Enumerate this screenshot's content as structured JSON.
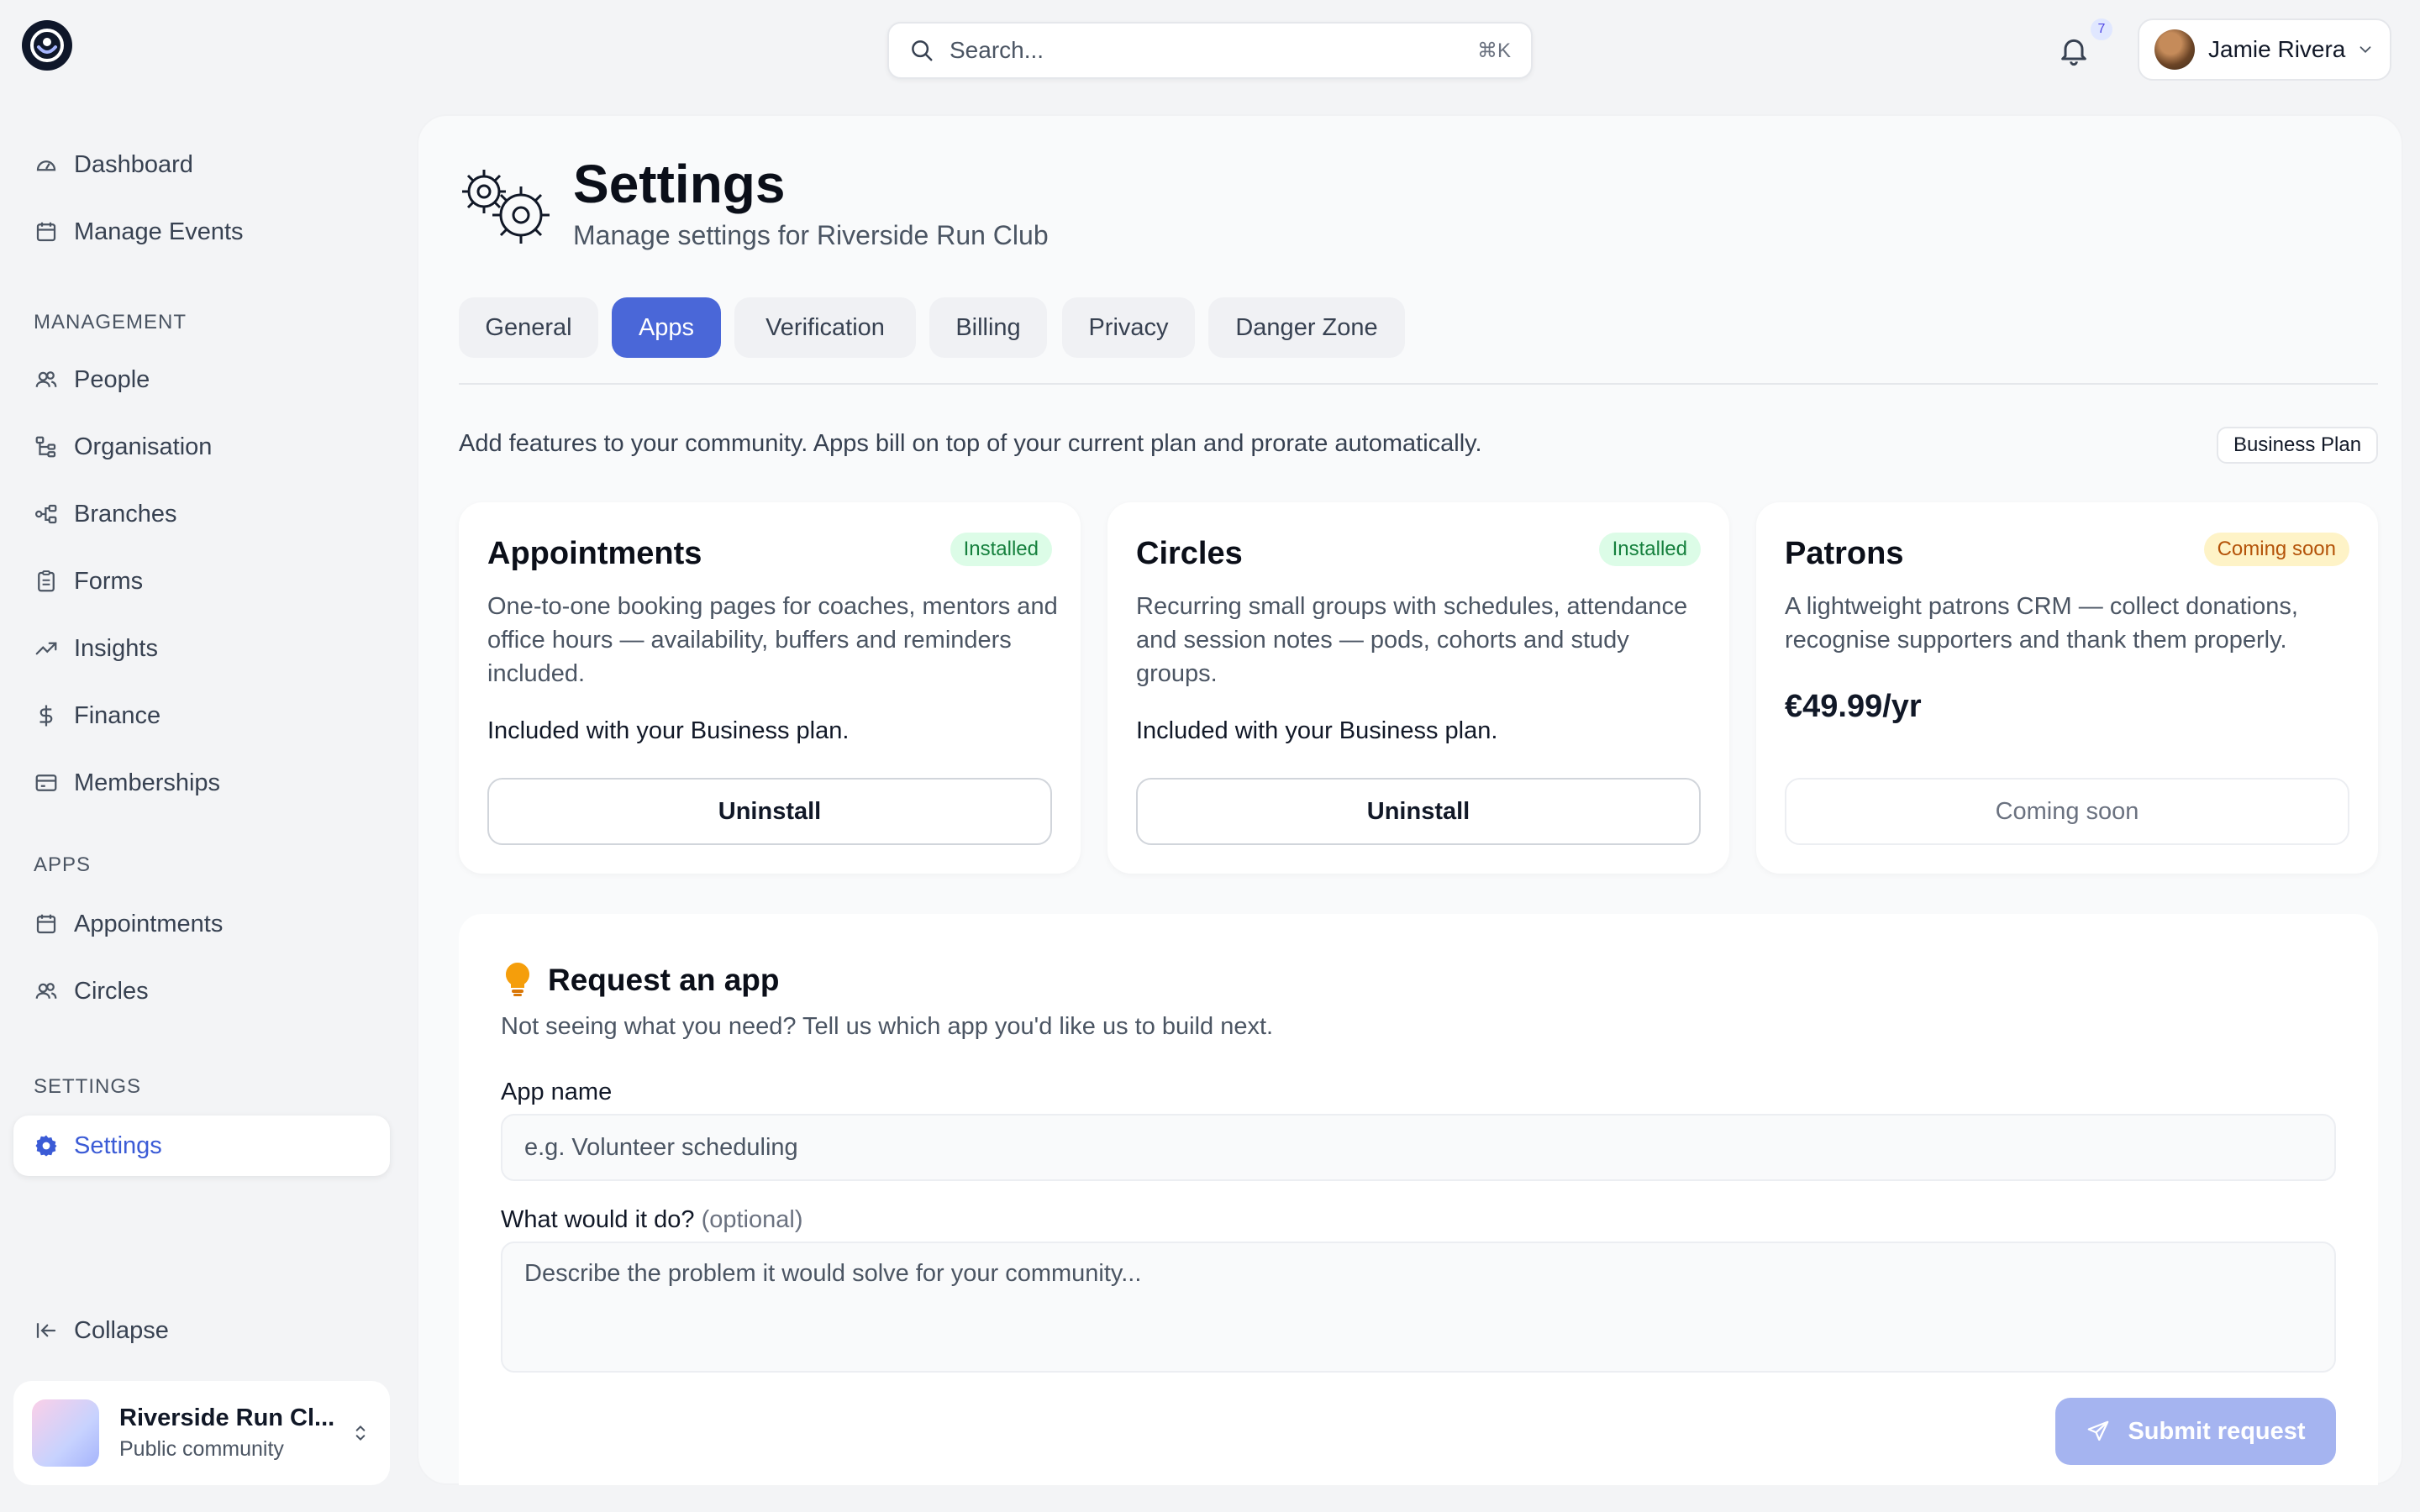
{
  "topbar": {
    "search_placeholder": "Search...",
    "search_shortcut": "⌘K",
    "notification_count": "7",
    "user_name": "Jamie Rivera"
  },
  "sidebar": {
    "top_items": [
      {
        "label": "Dashboard",
        "icon": "gauge-icon"
      },
      {
        "label": "Manage Events",
        "icon": "calendar-icon"
      }
    ],
    "management_label": "MANAGEMENT",
    "management_items": [
      {
        "label": "People",
        "icon": "users-icon"
      },
      {
        "label": "Organisation",
        "icon": "org-tree-icon"
      },
      {
        "label": "Branches",
        "icon": "branches-icon"
      },
      {
        "label": "Forms",
        "icon": "clipboard-icon"
      },
      {
        "label": "Insights",
        "icon": "trend-icon"
      },
      {
        "label": "Finance",
        "icon": "dollar-icon"
      },
      {
        "label": "Memberships",
        "icon": "card-icon"
      }
    ],
    "apps_label": "APPS",
    "apps_items": [
      {
        "label": "Appointments",
        "icon": "calendar-icon"
      },
      {
        "label": "Circles",
        "icon": "users-icon"
      }
    ],
    "settings_label": "SETTINGS",
    "settings_item": {
      "label": "Settings",
      "icon": "gear-icon"
    },
    "collapse_label": "Collapse",
    "community": {
      "name": "Riverside Run Cl...",
      "type": "Public community"
    }
  },
  "page": {
    "title": "Settings",
    "subtitle": "Manage settings for Riverside Run Club"
  },
  "tabs": [
    "General",
    "Apps",
    "Verification",
    "Billing",
    "Privacy",
    "Danger Zone"
  ],
  "active_tab": "Apps",
  "apps_intro": "Add features to your community. Apps bill on top of your current plan and prorate automatically.",
  "plan_badge": "Business Plan",
  "cards": [
    {
      "name": "Appointments",
      "badge": "Installed",
      "description": "One-to-one booking pages for coaches, mentors and office hours — availability, buffers and reminders included.",
      "included": "Included with your Business plan.",
      "button": "Uninstall"
    },
    {
      "name": "Circles",
      "badge": "Installed",
      "description": "Recurring small groups with schedules, attendance and session notes — pods, cohorts and study groups.",
      "included": "Included with your Business plan.",
      "button": "Uninstall"
    },
    {
      "name": "Patrons",
      "badge": "Coming soon",
      "description": "A lightweight patrons CRM — collect donations, recognise supporters and thank them properly.",
      "price": "€49.99/yr",
      "button": "Coming soon"
    }
  ],
  "request": {
    "title": "Request an app",
    "subtitle": "Not seeing what you need? Tell us which app you'd like us to build next.",
    "name_label": "App name",
    "name_placeholder": "e.g. Volunteer scheduling",
    "desc_label": "What would it do?",
    "desc_optional": "(optional)",
    "desc_placeholder": "Describe the problem it would solve for your community...",
    "submit_label": "Submit request"
  }
}
